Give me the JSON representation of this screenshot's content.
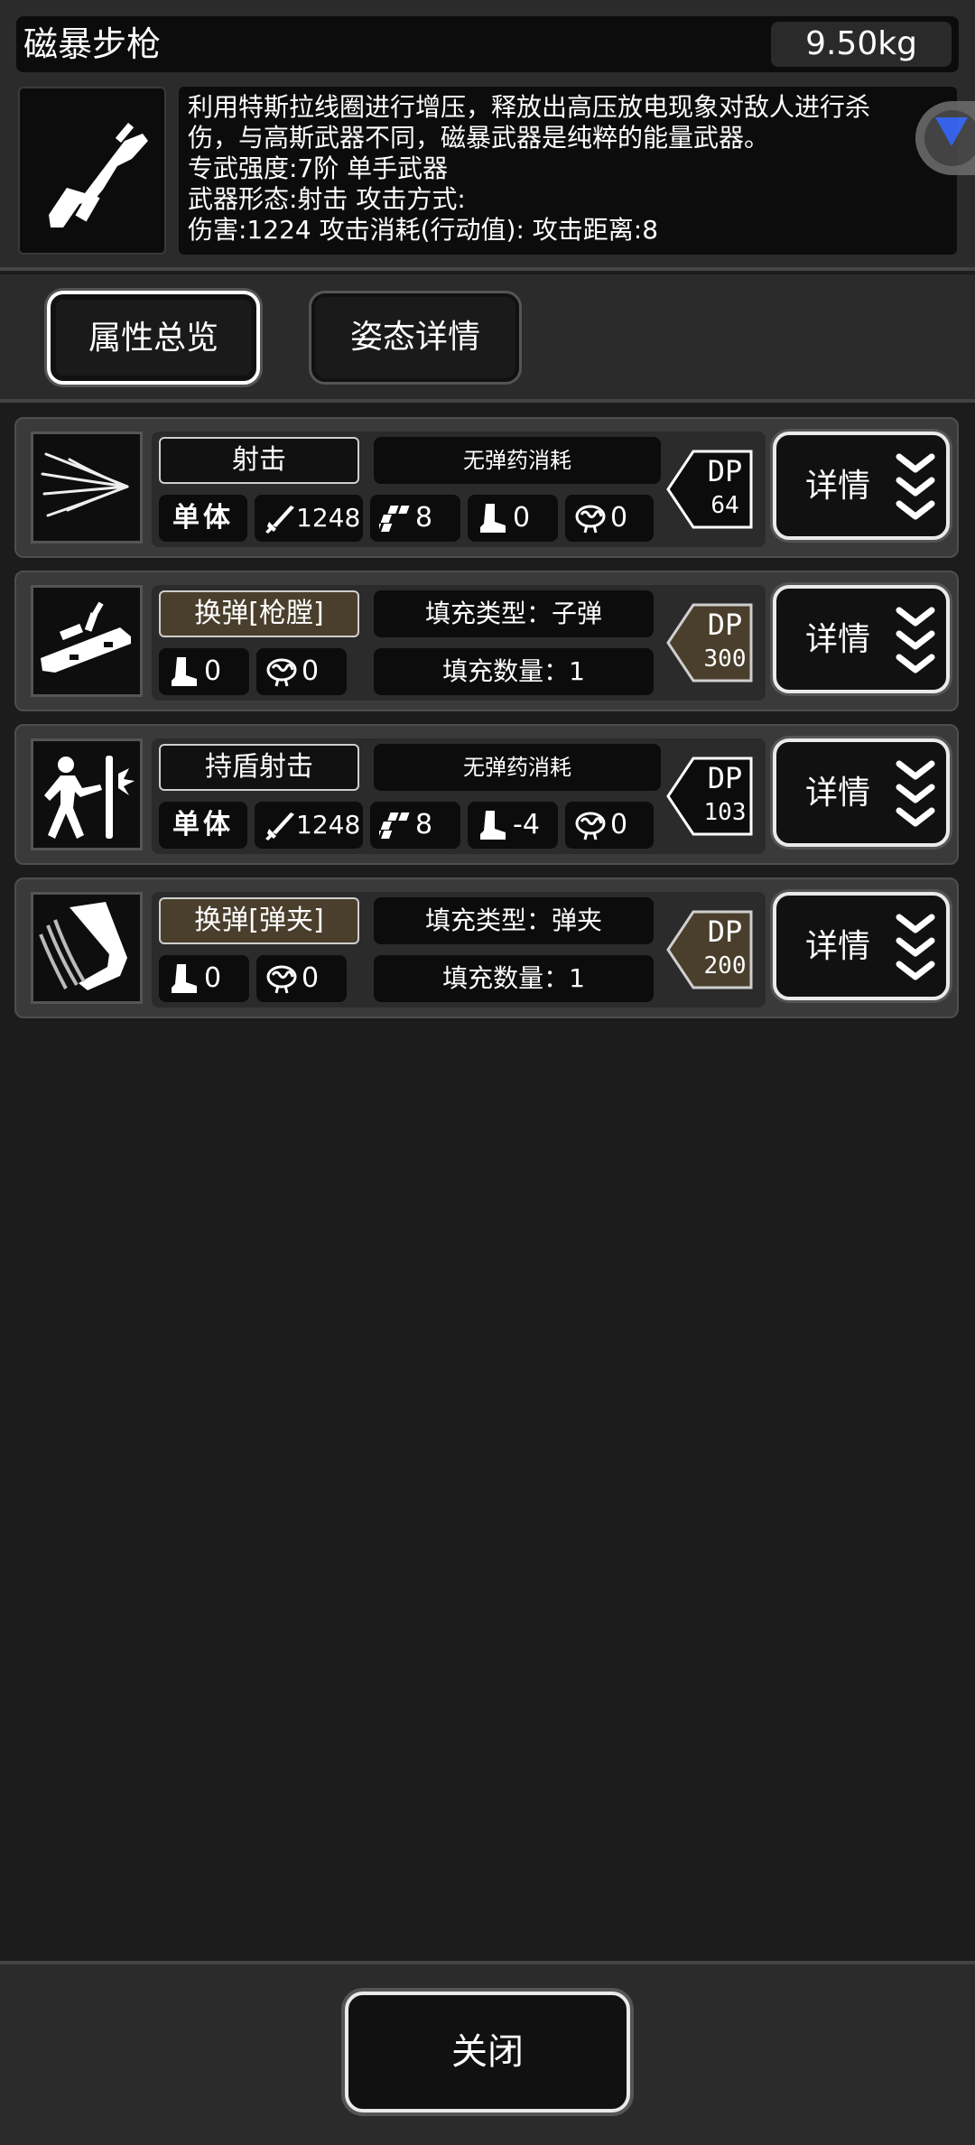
{
  "header": {
    "title": "磁暴步枪",
    "weight": "9.50kg",
    "weapon_icon": "rifle-icon",
    "description_lines": [
      "利用特斯拉线圈进行增压，释放出高压放电现象对敌人进行杀",
      "伤，与高斯武器不同，磁暴武器是纯粹的能量武器。",
      "专武强度:7阶 单手武器",
      "武器形态:射击 攻击方式:",
      " 伤害:1224 攻击消耗(行动值): 攻击距离:8"
    ]
  },
  "tabs": [
    {
      "label": "属性总览",
      "active": true
    },
    {
      "label": "姿态详情",
      "active": false
    }
  ],
  "actions": [
    {
      "name": "射击",
      "icon": "shoot-icon",
      "ammo": "无弹药消耗",
      "target": "单体",
      "damage": "1248",
      "range": "8",
      "move": "0",
      "mind": "0",
      "dp_label": "DP",
      "dp_value": "64",
      "detail_label": "详情"
    },
    {
      "name": "换弹[枪膛]",
      "icon": "reload-chamber-icon",
      "move": "0",
      "mind": "0",
      "fill_type": "填充类型：子弹",
      "fill_count": "填充数量：1",
      "dp_label": "DP",
      "dp_value": "300",
      "detail_label": "详情"
    },
    {
      "name": "持盾射击",
      "icon": "shield-shoot-icon",
      "ammo": "无弹药消耗",
      "target": "单体",
      "damage": "1248",
      "range": "8",
      "move": "-4",
      "mind": "0",
      "dp_label": "DP",
      "dp_value": "103",
      "detail_label": "详情"
    },
    {
      "name": "换弹[弹夹]",
      "icon": "reload-magazine-icon",
      "move": "0",
      "mind": "0",
      "fill_type": "填充类型：弹夹",
      "fill_count": "填充数量：1",
      "dp_label": "DP",
      "dp_value": "200",
      "detail_label": "详情"
    }
  ],
  "footer": {
    "close_label": "关闭"
  },
  "colors": {
    "panel": "#2b2b2b",
    "background": "#1c1c1c",
    "reload_accent": "#4a3f2c",
    "overlay_accent": "#3a6cff"
  }
}
